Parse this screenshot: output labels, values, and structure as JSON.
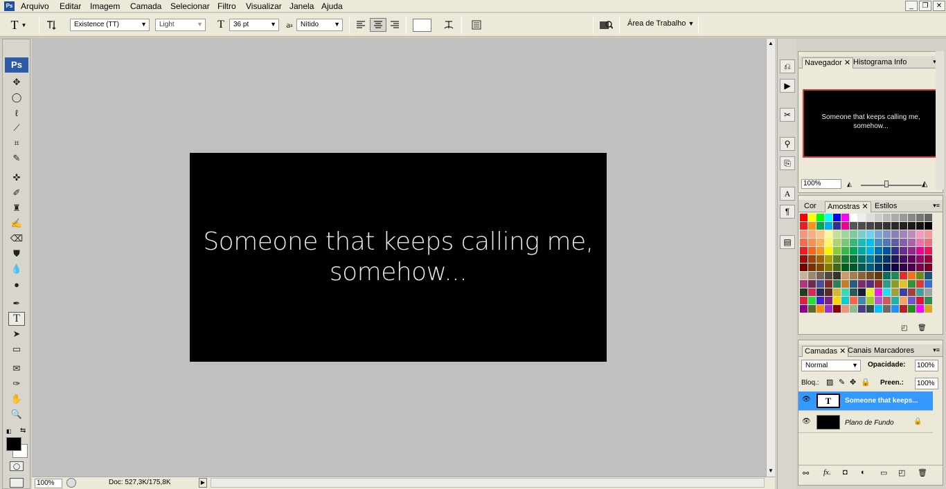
{
  "menubar": {
    "logo": "Ps",
    "items": [
      "Arquivo",
      "Editar",
      "Imagem",
      "Camada",
      "Selecionar",
      "Filtro",
      "Visualizar",
      "Janela",
      "Ajuda"
    ],
    "win_min": "_",
    "win_restore": "❐",
    "win_close": "✕"
  },
  "options": {
    "tool_glyph": "T",
    "font_family": "Existence (TT)",
    "font_style": "Light",
    "font_size": "36 pt",
    "aa_label": "a",
    "antialias": "Nítido",
    "workspace": "Área de Trabalho"
  },
  "document": {
    "line1": "Someone that keeps calling me,",
    "line2": "somehow..."
  },
  "status": {
    "zoom": "100%",
    "doc_info": "Doc: 527,3K/175,8K"
  },
  "navigator": {
    "tabs": [
      "Navegador",
      "Histograma",
      "Info"
    ],
    "thumb_line1": "Someone that keeps calling me,",
    "thumb_line2": "somehow...",
    "zoom": "100%"
  },
  "swatches_panel": {
    "tabs": [
      "Cor",
      "Amostras",
      "Estilos"
    ],
    "colors": [
      "#ff0000",
      "#ffff00",
      "#00ff00",
      "#00ffff",
      "#0000ff",
      "#ff00ff",
      "#ffffff",
      "#eeeeee",
      "#dddddd",
      "#cccccc",
      "#bbbbbb",
      "#aaaaaa",
      "#999999",
      "#888888",
      "#777777",
      "#666666",
      "#ec1c24",
      "#f7941d",
      "#00a651",
      "#00aeef",
      "#2e3192",
      "#ec008c",
      "#555555",
      "#4d4d4d",
      "#444444",
      "#3a3a3a",
      "#333333",
      "#2a2a2a",
      "#222222",
      "#1a1a1a",
      "#111111",
      "#000000",
      "#f69679",
      "#f9ad81",
      "#fdc689",
      "#fff799",
      "#c4df9b",
      "#a3d39c",
      "#82ca9d",
      "#7accc8",
      "#6dcff6",
      "#7da7d9",
      "#8393ca",
      "#8781bd",
      "#a186be",
      "#bd8cbf",
      "#f49ac1",
      "#f5989d",
      "#f26c4f",
      "#f68e56",
      "#fbaf5d",
      "#fff568",
      "#acd373",
      "#7cc576",
      "#3bb878",
      "#1abbb4",
      "#00bff3",
      "#448ccb",
      "#5674b9",
      "#605ca8",
      "#855fa8",
      "#a864a8",
      "#f06ea9",
      "#f26d7d",
      "#ed1c24",
      "#f26522",
      "#f7941d",
      "#fff200",
      "#8dc63f",
      "#39b54a",
      "#00a651",
      "#00a99d",
      "#00aeef",
      "#0072bc",
      "#0054a6",
      "#2e3192",
      "#662d91",
      "#92278f",
      "#ec008c",
      "#ed145b",
      "#9e0b0f",
      "#a0410d",
      "#a36209",
      "#aba000",
      "#598527",
      "#197b30",
      "#007236",
      "#00746b",
      "#0076a3",
      "#004a80",
      "#003471",
      "#1b1464",
      "#440e62",
      "#630460",
      "#9e005d",
      "#9e0039",
      "#790000",
      "#7b2e00",
      "#7d4900",
      "#827b00",
      "#406618",
      "#005e20",
      "#005826",
      "#005952",
      "#005b7f",
      "#003663",
      "#002157",
      "#0d004c",
      "#32004b",
      "#4b0049",
      "#7b0046",
      "#7a0026",
      "#c7b299",
      "#998675",
      "#736357",
      "#534741",
      "#37302d",
      "#c69c6d",
      "#a67c52",
      "#8c6239",
      "#754c24",
      "#603913",
      "#0b6e58",
      "#1e8a57",
      "#e12d2b",
      "#f86e1f",
      "#6b8c1c",
      "#1a4f80",
      "#b1367e",
      "#6d2b4f",
      "#4b4c9c",
      "#7f2a2a",
      "#2a7f5c",
      "#c47f2a",
      "#2a5c7f",
      "#7f2a6d",
      "#5c2a7f",
      "#9c2a2a",
      "#2a9c8a",
      "#8a9c2a",
      "#e2c12b",
      "#3a8d3a",
      "#d93b3b",
      "#3b6bd9",
      "#1e3f1e",
      "#d42a5a",
      "#2a2a5a",
      "#5a2a2a",
      "#d9b23b",
      "#3bd9b2",
      "#2a5a5a",
      "#1a1a3a",
      "#e0f020",
      "#f020e0",
      "#20e0f0",
      "#a0a040",
      "#4040a0",
      "#a04040",
      "#40a0a0",
      "#a0a0a0",
      "#e02040",
      "#20e040",
      "#4020e0",
      "#802080",
      "#ffd700",
      "#00ced1",
      "#ff6347",
      "#4682b4",
      "#9acd32",
      "#ba55d3",
      "#cd5c5c",
      "#20b2aa",
      "#f4a460",
      "#6a5acd",
      "#dc143c",
      "#2e8b57",
      "#8b008b",
      "#556b2f",
      "#ff8c00",
      "#9932cc",
      "#8b0000",
      "#e9967a",
      "#8fbc8f",
      "#483d8b",
      "#2f4f4f",
      "#00bfff",
      "#696969",
      "#1e90ff",
      "#b22222",
      "#228b22",
      "#ff00ff",
      "#daa520"
    ]
  },
  "layers_panel": {
    "tabs": [
      "Camadas",
      "Canais",
      "Marcadores"
    ],
    "blend_mode": "Normal",
    "opacity_label": "Opacidade:",
    "opacity": "100%",
    "lock_label": "Bloq.:",
    "fill_label": "Preen.:",
    "fill": "100%",
    "layers": [
      {
        "thumb": "T",
        "name": "Someone that keeps..."
      },
      {
        "thumb": "",
        "name": "Plano de Fundo"
      }
    ]
  }
}
